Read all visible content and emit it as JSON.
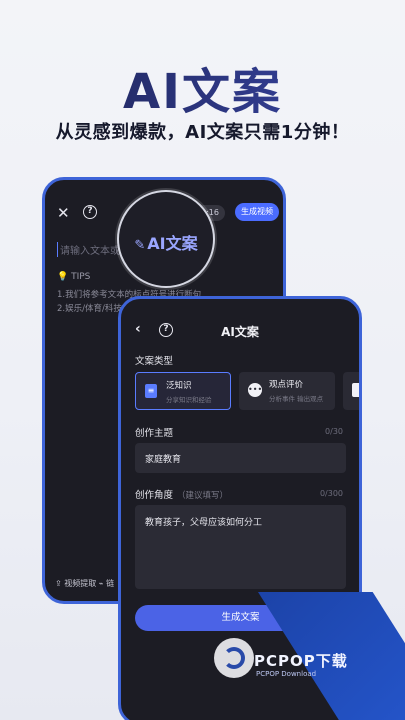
{
  "hero": {
    "title": "AI文案",
    "subtitle": "从灵感到爆款，AI文案只需1分钟！"
  },
  "back_phone": {
    "timer": "9:16",
    "generate_video_label": "生成视频",
    "input_placeholder": "请输入文本或",
    "tips_label": "TIPS",
    "tips": [
      "1.我们将参考文本的标点符号进行断句",
      "2.娱乐/体育/科技"
    ],
    "bottom_actions": "⇪ 视频提取   ⌁ 链"
  },
  "lens": {
    "label": "AI文案"
  },
  "front_phone": {
    "title": "AI文案",
    "type_section_label": "文案类型",
    "types": [
      {
        "name": "泛知识",
        "desc": "分享知识和经验"
      },
      {
        "name": "观点评价",
        "desc": "分析事件 输出观点"
      }
    ],
    "theme_label": "创作主题",
    "theme_count": "0/30",
    "theme_value": "家庭教育",
    "angle_label": "创作角度",
    "angle_hint": "（建议填写）",
    "angle_count": "0/300",
    "angle_value": "教育孩子，父母应该如何分工",
    "generate_label": "生成文案"
  },
  "watermark": {
    "brand": "PCPOP下载",
    "sub": "PCPOP Download"
  }
}
